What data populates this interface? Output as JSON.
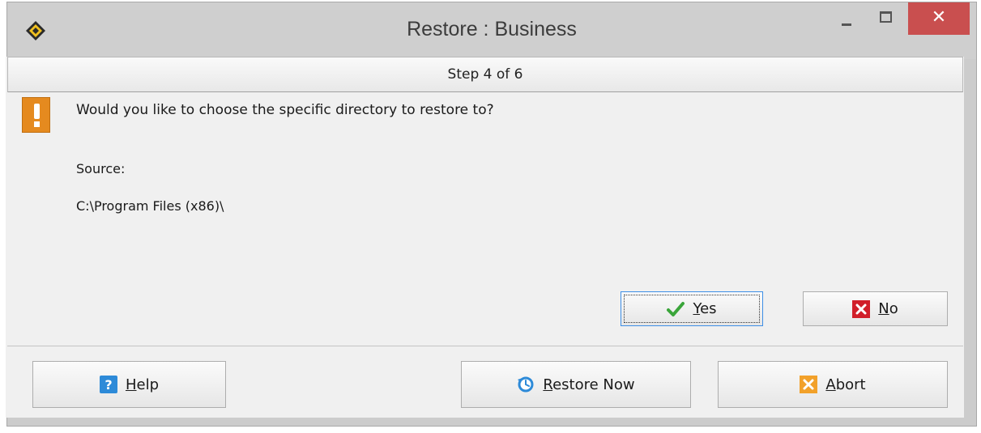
{
  "window": {
    "title": "Restore : Business",
    "close_glyph": "✕"
  },
  "step": {
    "label": "Step 4 of 6"
  },
  "message": {
    "question": "Would you like to choose the specific directory to restore to?",
    "source_label": "Source:",
    "source_path": "C:\\Program Files (x86)\\"
  },
  "buttons": {
    "yes": {
      "mnemonic": "Y",
      "rest": "es",
      "icon": "checkmark-icon"
    },
    "no": {
      "mnemonic": "N",
      "rest": "o",
      "icon": "x-icon"
    },
    "help": {
      "mnemonic": "H",
      "rest": "elp",
      "icon": "help-icon"
    },
    "restore_now": {
      "mnemonic": "R",
      "rest": "estore Now",
      "icon": "clock-restore-icon"
    },
    "abort": {
      "mnemonic": "A",
      "rest": "bort",
      "icon": "abort-icon"
    }
  },
  "colors": {
    "close_button": "#c94f4f",
    "warning_icon": "#e58a1f",
    "yes_check": "#3aa53a",
    "no_x": "#d11f2a",
    "help_icon": "#2d8ad8",
    "abort_icon": "#f2a12a"
  }
}
